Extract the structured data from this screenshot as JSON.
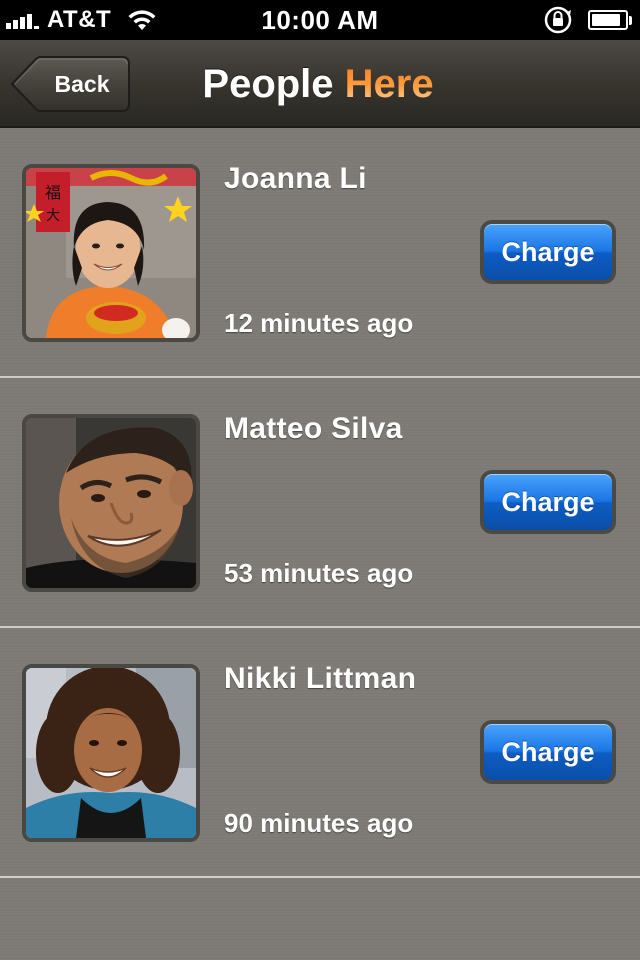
{
  "status_bar": {
    "carrier": "AT&T",
    "time": "10:00 AM",
    "signal_bars": 4,
    "battery_level": 0.9
  },
  "nav": {
    "back_label": "Back",
    "title_part1": "People ",
    "title_part2": "Here",
    "title_accent_color": "#ff8a2a"
  },
  "people": [
    {
      "name": "Joanna Li",
      "time_ago": "12 minutes ago",
      "action_label": "Charge"
    },
    {
      "name": "Matteo Silva",
      "time_ago": "53 minutes ago",
      "action_label": "Charge"
    },
    {
      "name": "Nikki Littman",
      "time_ago": "90 minutes ago",
      "action_label": "Charge"
    }
  ],
  "colors": {
    "charge_button": "#1a76e3",
    "background": "#7e7b76",
    "nav_bar": "#38352f"
  },
  "icons": {
    "signal": "cellular-signal-icon",
    "wifi": "wifi-icon",
    "rotation_lock": "rotation-lock-icon",
    "battery": "battery-icon"
  }
}
